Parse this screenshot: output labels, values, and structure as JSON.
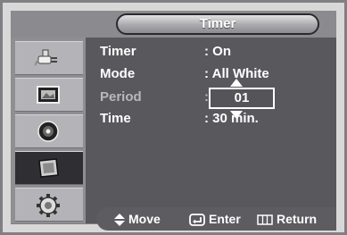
{
  "menu": {
    "title": "Timer"
  },
  "sidebar": {
    "items": [
      {
        "icon": "input-plug-icon"
      },
      {
        "icon": "picture-icon"
      },
      {
        "icon": "sound-speaker-icon"
      },
      {
        "icon": "setup-screen-icon",
        "active": true
      },
      {
        "icon": "gear-icon"
      }
    ]
  },
  "settings": [
    {
      "label": "Timer",
      "value": ": On"
    },
    {
      "label": "Mode",
      "value": ": All White"
    },
    {
      "label": "Period",
      "value": ":"
    },
    {
      "label": "Time",
      "value": ": 30 min."
    }
  ],
  "period_box": {
    "value": "01"
  },
  "footer": {
    "move": "Move",
    "enter": "Enter",
    "return": "Return"
  },
  "colors": {
    "background": "#7f7f84",
    "content": "#58585d",
    "active_item": "#2f2f33",
    "text": "#ffffff",
    "dim_text": "#b9b9bd"
  }
}
